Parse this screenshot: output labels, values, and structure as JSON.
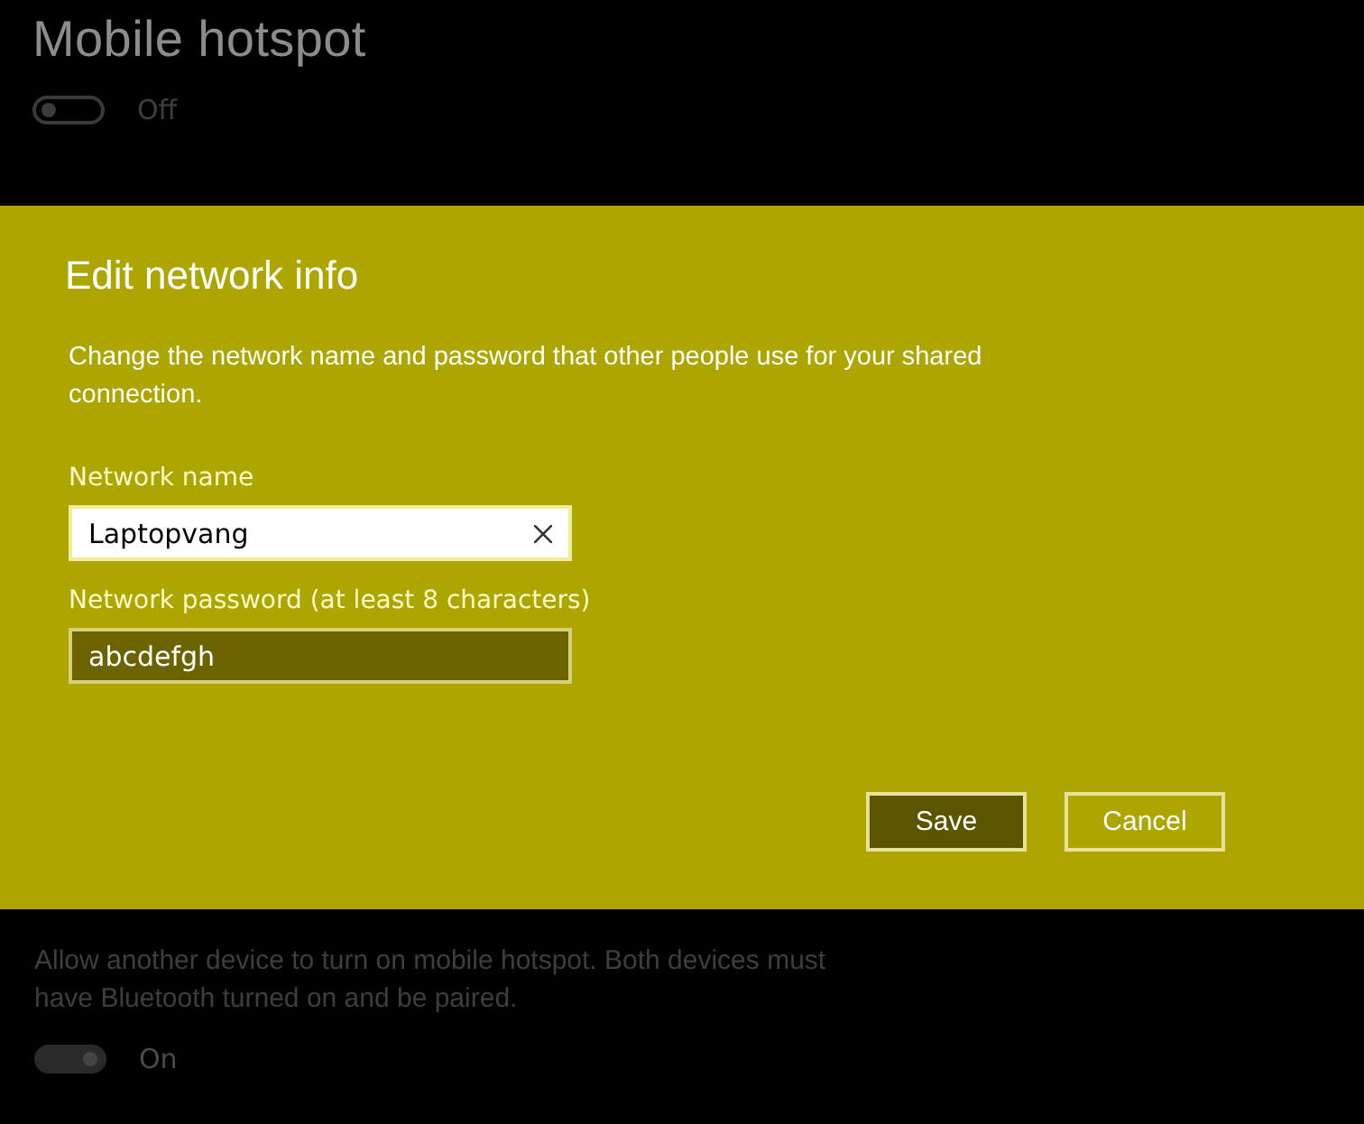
{
  "page": {
    "title": "Mobile hotspot"
  },
  "hotspot_toggle": {
    "on": false,
    "label": "Off"
  },
  "dialog": {
    "title": "Edit network info",
    "description": "Change the network name and password that other people use for your shared connection.",
    "fields": [
      {
        "label": "Network name",
        "value": "Laptopvang",
        "focused": true
      },
      {
        "label": "Network password (at least 8 characters)",
        "value": "abcdefgh",
        "focused": false
      }
    ],
    "buttons": [
      {
        "label": "Save",
        "primary": true
      },
      {
        "label": "Cancel",
        "primary": false
      }
    ]
  },
  "bluetooth": {
    "description": "Allow another device to turn on mobile hotspot. Both devices must have Bluetooth turned on and be paired.",
    "toggle": {
      "on": true,
      "label": "On"
    }
  }
}
